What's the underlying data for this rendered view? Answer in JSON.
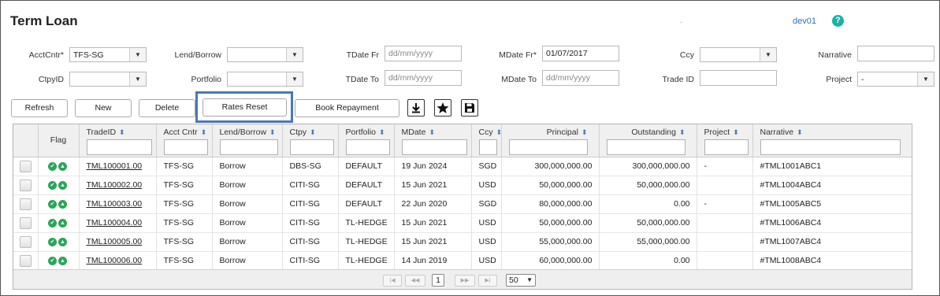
{
  "header": {
    "title": "Term Loan",
    "dot": ".",
    "user": "dev01",
    "help_icon": "?"
  },
  "filters": {
    "acctcntr": {
      "label": "AcctCntr*",
      "value": "TFS-SG"
    },
    "lend_borrow": {
      "label": "Lend/Borrow",
      "value": ""
    },
    "tdate_fr": {
      "label": "TDate Fr",
      "placeholder": "dd/mm/yyyy"
    },
    "mdate_fr": {
      "label": "MDate Fr*",
      "value": "01/07/2017"
    },
    "ccy": {
      "label": "Ccy",
      "value": ""
    },
    "narrative": {
      "label": "Narrative",
      "value": ""
    },
    "ctpyid": {
      "label": "CtpyID",
      "value": ""
    },
    "portfolio": {
      "label": "Portfolio",
      "value": ""
    },
    "tdate_to": {
      "label": "TDate To",
      "placeholder": "dd/mm/yyyy"
    },
    "mdate_to": {
      "label": "MDate To",
      "placeholder": "dd/mm/yyyy"
    },
    "trade_id": {
      "label": "Trade ID",
      "value": ""
    },
    "project": {
      "label": "Project",
      "value": "-"
    }
  },
  "toolbar": {
    "refresh": "Refresh",
    "new": "New",
    "delete": "Delete",
    "rates_reset": "Rates Reset",
    "book_repayment": "Book Repayment",
    "download_icon": "download-icon",
    "star_icon": "star-icon",
    "save_icon": "save-icon"
  },
  "table": {
    "columns": [
      "Flag",
      "TradeID",
      "Acct Cntr",
      "Lend/Borrow",
      "Ctpy",
      "Portfolio",
      "MDate",
      "Ccy",
      "Principal",
      "Outstanding",
      "Project",
      "Narrative"
    ],
    "rows": [
      {
        "trade_id": "TML100001.00",
        "acct_cntr": "TFS-SG",
        "lend_borrow": "Borrow",
        "ctpy": "DBS-SG",
        "portfolio": "DEFAULT",
        "mdate": "19 Jun 2024",
        "ccy": "SGD",
        "principal": "300,000,000.00",
        "outstanding": "300,000,000.00",
        "project": "-",
        "narrative": "#TML1001ABC1"
      },
      {
        "trade_id": "TML100002.00",
        "acct_cntr": "TFS-SG",
        "lend_borrow": "Borrow",
        "ctpy": "CITI-SG",
        "portfolio": "DEFAULT",
        "mdate": "15 Jun 2021",
        "ccy": "USD",
        "principal": "50,000,000.00",
        "outstanding": "50,000,000.00",
        "project": "",
        "narrative": "#TML1004ABC4"
      },
      {
        "trade_id": "TML100003.00",
        "acct_cntr": "TFS-SG",
        "lend_borrow": "Borrow",
        "ctpy": "CITI-SG",
        "portfolio": "DEFAULT",
        "mdate": "22 Jun 2020",
        "ccy": "SGD",
        "principal": "80,000,000.00",
        "outstanding": "0.00",
        "project": "-",
        "narrative": "#TML1005ABC5"
      },
      {
        "trade_id": "TML100004.00",
        "acct_cntr": "TFS-SG",
        "lend_borrow": "Borrow",
        "ctpy": "CITI-SG",
        "portfolio": "TL-HEDGE",
        "mdate": "15 Jun 2021",
        "ccy": "USD",
        "principal": "50,000,000.00",
        "outstanding": "50,000,000.00",
        "project": "",
        "narrative": "#TML1006ABC4"
      },
      {
        "trade_id": "TML100005.00",
        "acct_cntr": "TFS-SG",
        "lend_borrow": "Borrow",
        "ctpy": "CITI-SG",
        "portfolio": "TL-HEDGE",
        "mdate": "15 Jun 2021",
        "ccy": "USD",
        "principal": "55,000,000.00",
        "outstanding": "55,000,000.00",
        "project": "",
        "narrative": "#TML1007ABC4"
      },
      {
        "trade_id": "TML100006.00",
        "acct_cntr": "TFS-SG",
        "lend_borrow": "Borrow",
        "ctpy": "CITI-SG",
        "portfolio": "TL-HEDGE",
        "mdate": "14 Jun 2019",
        "ccy": "USD",
        "principal": "60,000,000.00",
        "outstanding": "0.00",
        "project": "",
        "narrative": "#TML1008ABC4"
      }
    ]
  },
  "pager": {
    "first": "|◀",
    "prev": "◀◀",
    "page": "1",
    "next": "▶▶",
    "last": "▶|",
    "page_size": "50"
  },
  "colors": {
    "accent": "#4a78b8",
    "flag": "#2aa65a",
    "help": "#19b3a6",
    "user_link": "#2a74b5"
  }
}
